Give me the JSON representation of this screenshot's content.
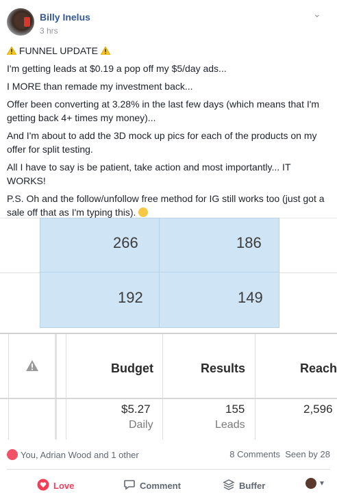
{
  "post": {
    "author": "Billy Inelus",
    "time": "3 hrs",
    "lines": [
      "FUNNEL UPDATE",
      "I'm getting leads at $0.19 a pop off my $5/day ads...",
      "I MORE than remade my investment back...",
      "Offer been converting at 3.28% in the last few days (which means that I'm getting back 4+ times my money)...",
      "And I'm about to add the 3D mock up pics for each of the products on my offer for split testing.",
      "All I have to say is be patient, take action and most importantly... IT WORKS!",
      "P.S. Oh and the follow/unfollow free method for IG still works too (just got a sale off that as I'm typing this)."
    ]
  },
  "screenshot": {
    "top_row": [
      "266",
      "186"
    ],
    "second_row": [
      "192",
      "149"
    ],
    "headers": {
      "budget": "Budget",
      "results": "Results",
      "reach": "Reach"
    },
    "row": {
      "budget": "$5.27",
      "budget_sub": "Daily",
      "results": "155",
      "results_sub": "Leads",
      "reach": "2,596"
    }
  },
  "footer": {
    "reactions": "You, Adrian Wood and 1 other",
    "comments": "8 Comments",
    "seen": "Seen by 28",
    "love": "Love",
    "comment": "Comment",
    "buffer": "Buffer"
  },
  "colors": {
    "link": "#365899",
    "love": "#f33e58",
    "table_highlight": "#cfe4f4"
  }
}
